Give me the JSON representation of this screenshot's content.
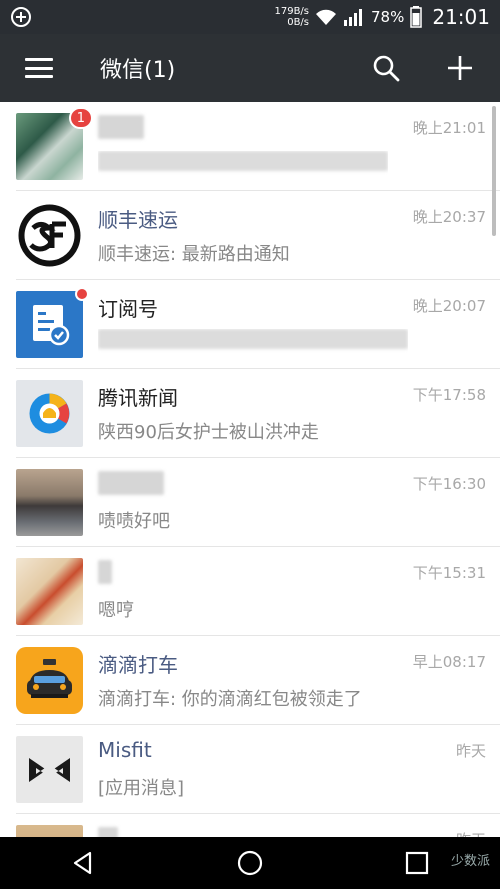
{
  "status": {
    "net_up": "179B/s",
    "net_down": "0B/s",
    "battery": "78%",
    "time": "21:01"
  },
  "appbar": {
    "title": "微信(1)"
  },
  "chats": [
    {
      "name": "",
      "preview": "",
      "time": "晚上21:01",
      "badge": "1",
      "avatar": "photo-green"
    },
    {
      "name": "顺丰速运",
      "preview": "顺丰速运: 最新路由通知",
      "time": "晚上20:37",
      "avatar": "sf-logo"
    },
    {
      "name": "订阅号",
      "preview": "",
      "time": "晚上20:07",
      "avatar": "subscription-icon"
    },
    {
      "name": "腾讯新闻",
      "preview": "陕西90后女护士被山洪冲走",
      "time": "下午17:58",
      "avatar": "tencent-news-logo"
    },
    {
      "name": "",
      "preview": "啧啧好吧",
      "time": "下午16:30",
      "avatar": "photo-person"
    },
    {
      "name": "",
      "preview": "嗯哼",
      "time": "下午15:31",
      "avatar": "photo-flower"
    },
    {
      "name": "滴滴打车",
      "preview": "滴滴打车: 你的滴滴红包被领走了",
      "time": "早上08:17",
      "avatar": "didi-logo"
    },
    {
      "name": "Misfit",
      "preview": "[应用消息]",
      "time": "昨天",
      "avatar": "misfit-logo"
    },
    {
      "name": "",
      "preview": "",
      "time": "昨天",
      "avatar": "photo-partial"
    }
  ],
  "watermark": "少数派"
}
